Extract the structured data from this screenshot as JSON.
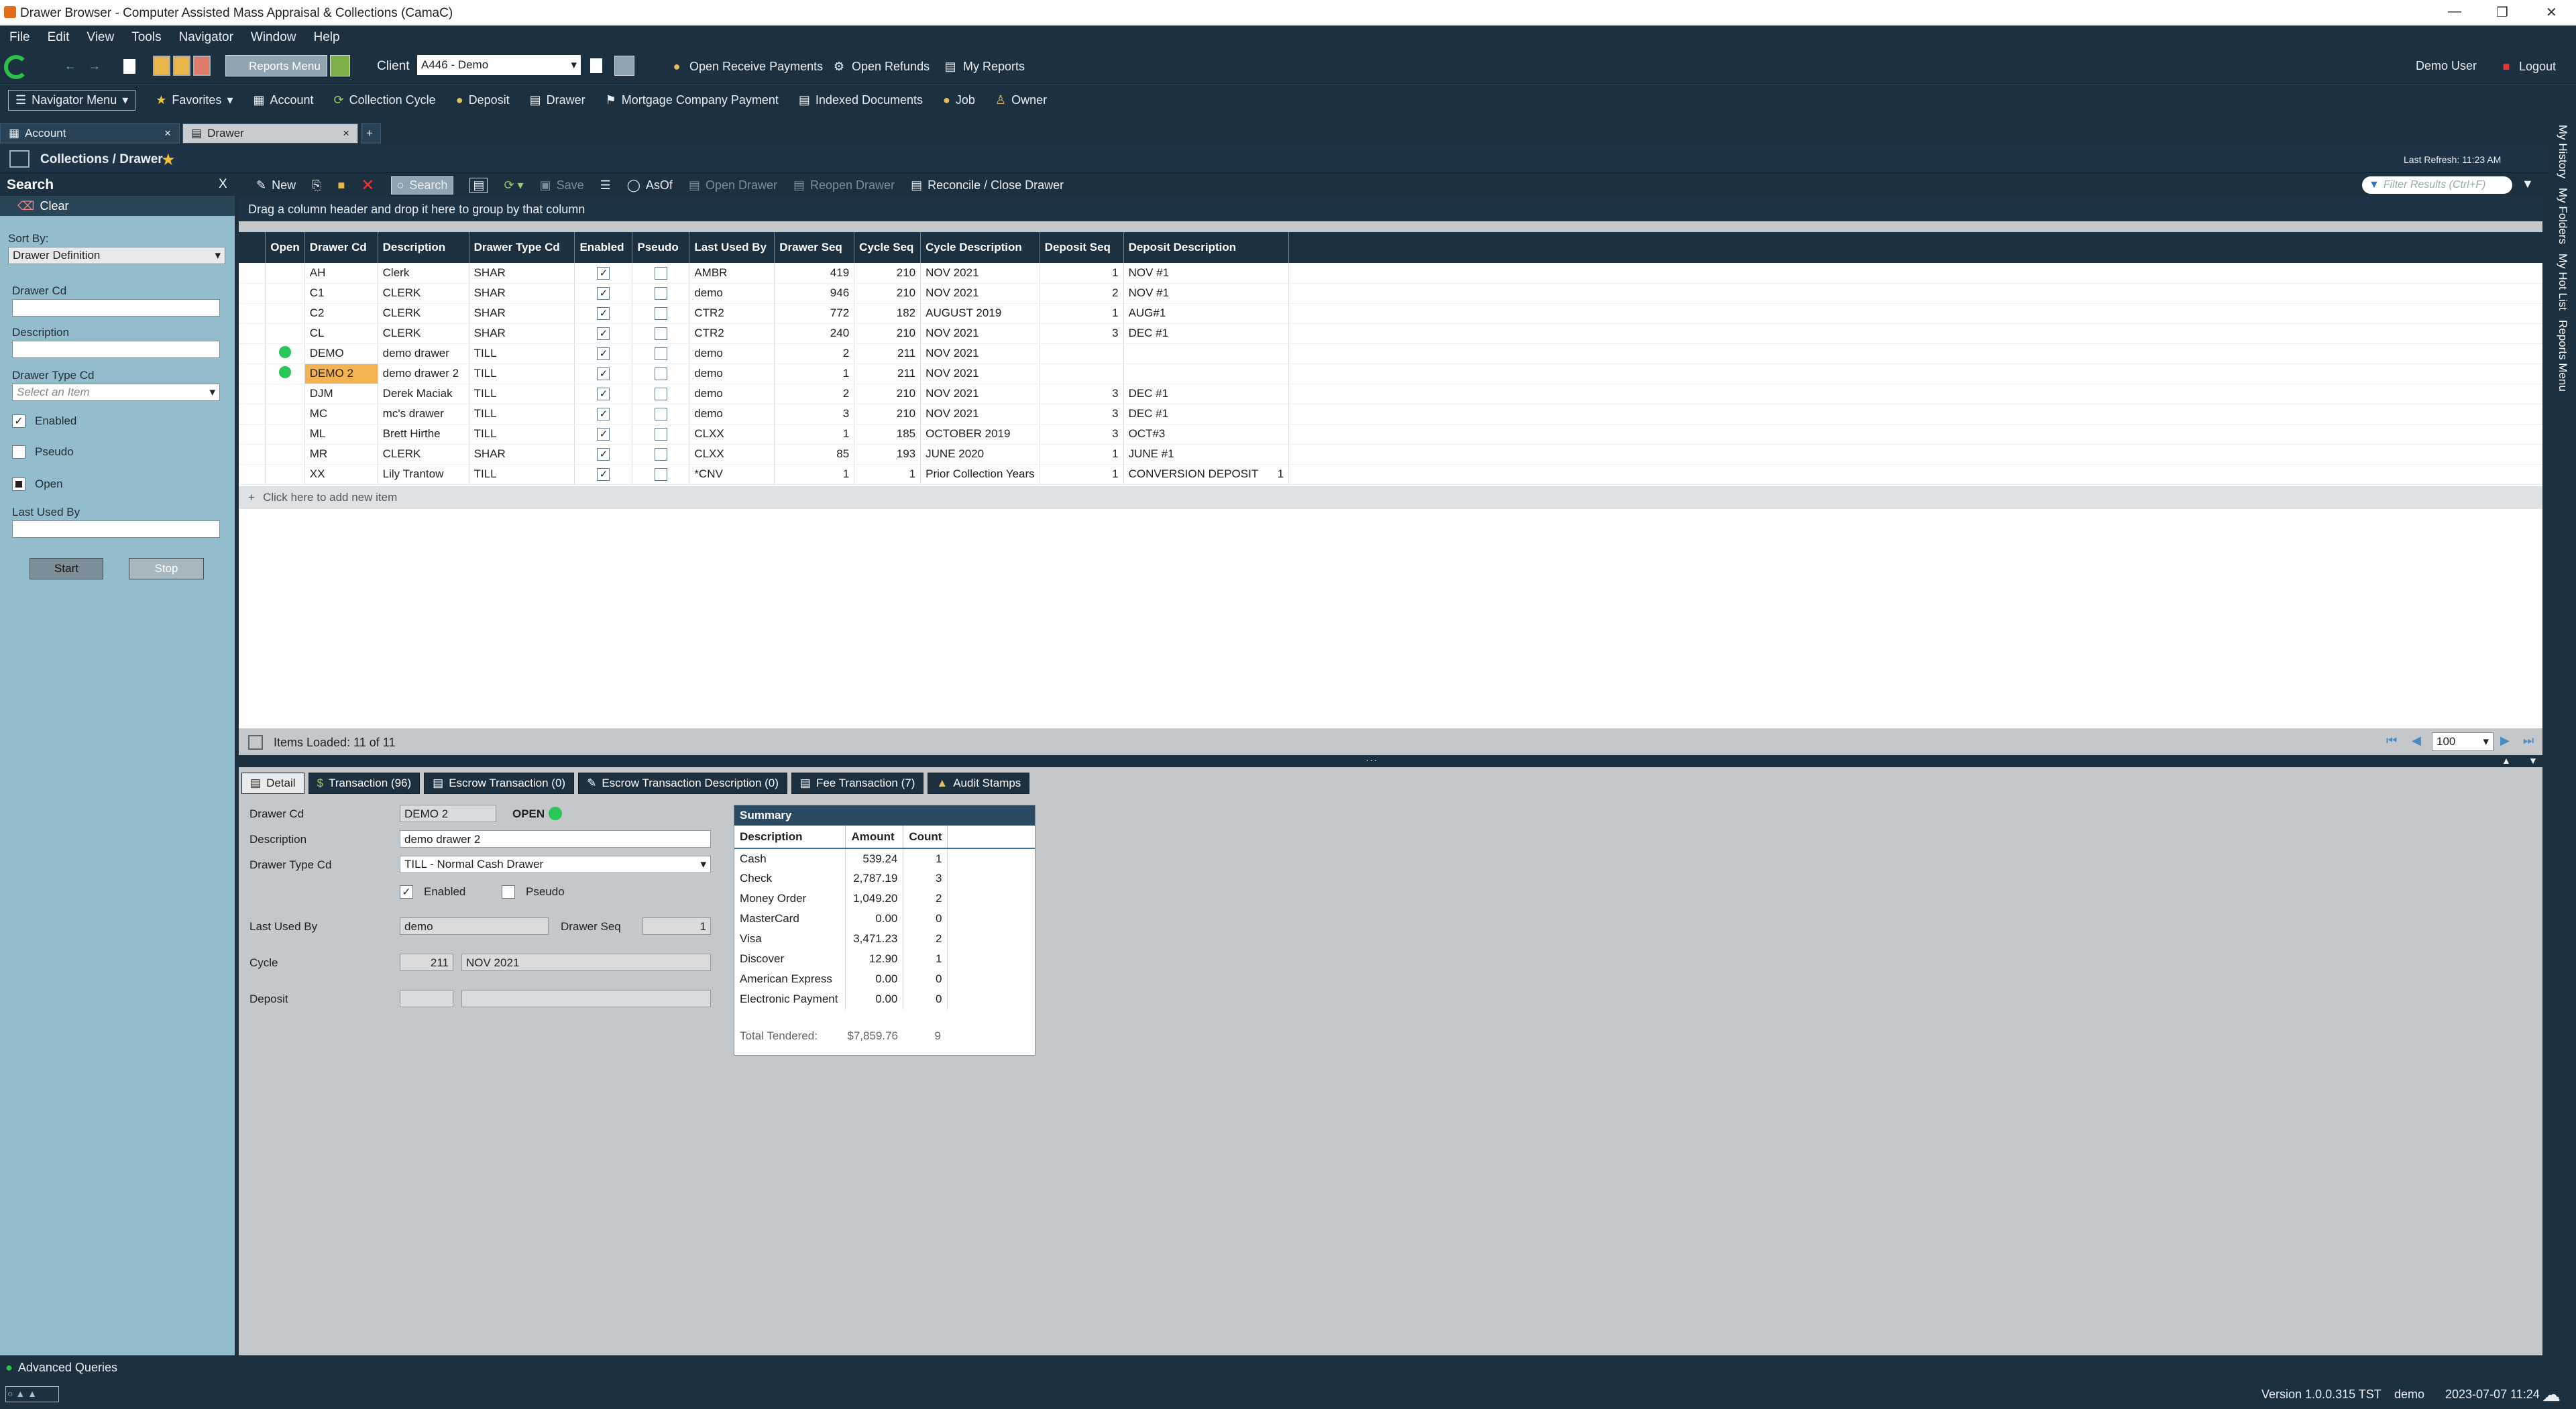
{
  "window": {
    "title": "Drawer Browser - Computer Assisted Mass Appraisal & Collections (CamaC)"
  },
  "menu": [
    "File",
    "Edit",
    "View",
    "Tools",
    "Navigator",
    "Window",
    "Help"
  ],
  "toolbar": {
    "reports_menu": "Reports Menu",
    "client_label": "Client",
    "client_value": "A446 - Demo",
    "open_receive_payments": "Open Receive Payments",
    "open_refunds": "Open Refunds",
    "my_reports": "My Reports",
    "user": "Demo User",
    "logout": "Logout"
  },
  "navbar": {
    "navigator_menu": "Navigator Menu",
    "favorites": "Favorites",
    "items": [
      "Account",
      "Collection Cycle",
      "Deposit",
      "Drawer",
      "Mortgage Company Payment",
      "Indexed Documents",
      "Job",
      "Owner"
    ]
  },
  "doc_tabs": [
    {
      "label": "Account"
    },
    {
      "label": "Drawer"
    }
  ],
  "breadcrumb": {
    "title": "Collections / Drawer",
    "last_refresh": "Last Refresh:  11:23 AM"
  },
  "search_panel": {
    "title": "Search",
    "close": "X",
    "clear": "Clear",
    "sort_by_label": "Sort By:",
    "sort_by_value": "Drawer Definition",
    "drawer_cd_label": "Drawer Cd",
    "description_label": "Description",
    "drawer_type_label": "Drawer Type Cd",
    "drawer_type_placeholder": "Select an Item",
    "enabled_label": "Enabled",
    "pseudo_label": "Pseudo",
    "open_label": "Open",
    "last_used_by_label": "Last Used By",
    "start": "Start",
    "stop": "Stop"
  },
  "grid_toolbar": {
    "new": "New",
    "search": "Search",
    "save": "Save",
    "asof": "AsOf",
    "open_drawer": "Open Drawer",
    "reopen_drawer": "Reopen Drawer",
    "reconcile": "Reconcile / Close Drawer",
    "filter_placeholder": "Filter Results (Ctrl+F)"
  },
  "group_hint": "Drag a column header and drop it here to group by that column",
  "grid": {
    "columns": [
      "Open",
      "Drawer Cd",
      "Description",
      "Drawer Type Cd",
      "Enabled",
      "Pseudo",
      "Last Used By",
      "Drawer Seq",
      "Cycle Seq",
      "Cycle Description",
      "Deposit Seq",
      "Deposit Description"
    ],
    "rows": [
      {
        "open": false,
        "cd": "AH",
        "desc": "Clerk",
        "type": "SHAR",
        "enabled": true,
        "pseudo": false,
        "last": "AMBR",
        "dseq": "419",
        "cseq": "210",
        "cdesc": "NOV 2021",
        "depseq": "1",
        "depdesc": "NOV #1",
        "extra": ""
      },
      {
        "open": false,
        "cd": "C1",
        "desc": "CLERK",
        "type": "SHAR",
        "enabled": true,
        "pseudo": false,
        "last": "demo",
        "dseq": "946",
        "cseq": "210",
        "cdesc": "NOV 2021",
        "depseq": "2",
        "depdesc": "NOV #1",
        "extra": ""
      },
      {
        "open": false,
        "cd": "C2",
        "desc": "CLERK",
        "type": "SHAR",
        "enabled": true,
        "pseudo": false,
        "last": "CTR2",
        "dseq": "772",
        "cseq": "182",
        "cdesc": "AUGUST 2019",
        "depseq": "1",
        "depdesc": "AUG#1",
        "extra": ""
      },
      {
        "open": false,
        "cd": "CL",
        "desc": "CLERK",
        "type": "SHAR",
        "enabled": true,
        "pseudo": false,
        "last": "CTR2",
        "dseq": "240",
        "cseq": "210",
        "cdesc": "NOV 2021",
        "depseq": "3",
        "depdesc": "DEC #1",
        "extra": ""
      },
      {
        "open": true,
        "cd": "DEMO",
        "desc": "demo drawer",
        "type": "TILL",
        "enabled": true,
        "pseudo": false,
        "last": "demo",
        "dseq": "2",
        "cseq": "211",
        "cdesc": "NOV 2021",
        "depseq": "",
        "depdesc": "",
        "extra": ""
      },
      {
        "open": true,
        "cd": "DEMO 2",
        "desc": "demo drawer 2",
        "type": "TILL",
        "enabled": true,
        "pseudo": false,
        "last": "demo",
        "dseq": "1",
        "cseq": "211",
        "cdesc": "NOV 2021",
        "depseq": "",
        "depdesc": "",
        "extra": "",
        "selected": true
      },
      {
        "open": false,
        "cd": "DJM",
        "desc": "Derek Maciak",
        "type": "TILL",
        "enabled": true,
        "pseudo": false,
        "last": "demo",
        "dseq": "2",
        "cseq": "210",
        "cdesc": "NOV 2021",
        "depseq": "3",
        "depdesc": "DEC #1",
        "extra": ""
      },
      {
        "open": false,
        "cd": "MC",
        "desc": "mc's drawer",
        "type": "TILL",
        "enabled": true,
        "pseudo": false,
        "last": "demo",
        "dseq": "3",
        "cseq": "210",
        "cdesc": "NOV 2021",
        "depseq": "3",
        "depdesc": "DEC #1",
        "extra": ""
      },
      {
        "open": false,
        "cd": "ML",
        "desc": "Brett Hirthe",
        "type": "TILL",
        "enabled": true,
        "pseudo": false,
        "last": "CLXX",
        "dseq": "1",
        "cseq": "185",
        "cdesc": "OCTOBER 2019",
        "depseq": "3",
        "depdesc": "OCT#3",
        "extra": ""
      },
      {
        "open": false,
        "cd": "MR",
        "desc": "CLERK",
        "type": "SHAR",
        "enabled": true,
        "pseudo": false,
        "last": "CLXX",
        "dseq": "85",
        "cseq": "193",
        "cdesc": "JUNE 2020",
        "depseq": "1",
        "depdesc": "JUNE #1",
        "extra": ""
      },
      {
        "open": false,
        "cd": "XX",
        "desc": "Lily Trantow",
        "type": "TILL",
        "enabled": true,
        "pseudo": false,
        "last": "*CNV",
        "dseq": "1",
        "cseq": "1",
        "cdesc": "Prior Collection Years",
        "depseq": "1",
        "depdesc": "CONVERSION DEPOSIT",
        "extra": "1"
      }
    ],
    "add_new": "Click here to add new item",
    "items_loaded": "Items Loaded:  11 of 11",
    "page_size": "100"
  },
  "detail_tabs": [
    "Detail",
    "Transaction (96)",
    "Escrow Transaction (0)",
    "Escrow Transaction Description (0)",
    "Fee Transaction (7)",
    "Audit Stamps"
  ],
  "detail": {
    "drawer_cd_label": "Drawer Cd",
    "drawer_cd": "DEMO 2",
    "status": "OPEN",
    "description_label": "Description",
    "description": "demo drawer 2",
    "type_label": "Drawer Type Cd",
    "type_value": "TILL - Normal Cash Drawer",
    "enabled_label": "Enabled",
    "pseudo_label": "Pseudo",
    "last_used_label": "Last Used By",
    "last_used": "demo",
    "drawer_seq_label": "Drawer Seq",
    "drawer_seq": "1",
    "cycle_label": "Cycle",
    "cycle_num": "211",
    "cycle_desc": "NOV 2021",
    "deposit_label": "Deposit"
  },
  "summary": {
    "title": "Summary",
    "columns": [
      "Description",
      "Amount",
      "Count"
    ],
    "rows": [
      {
        "d": "Cash",
        "a": "539.24",
        "c": "1"
      },
      {
        "d": "Check",
        "a": "2,787.19",
        "c": "3"
      },
      {
        "d": "Money Order",
        "a": "1,049.20",
        "c": "2"
      },
      {
        "d": "MasterCard",
        "a": "0.00",
        "c": "0"
      },
      {
        "d": "Visa",
        "a": "3,471.23",
        "c": "2"
      },
      {
        "d": "Discover",
        "a": "12.90",
        "c": "1"
      },
      {
        "d": "American Express",
        "a": "0.00",
        "c": "0"
      },
      {
        "d": "Electronic Payment",
        "a": "0.00",
        "c": "0"
      }
    ],
    "total_label": "Total Tendered:",
    "total_amount": "$7,859.76",
    "total_count": "9"
  },
  "right_tabs": [
    "My History",
    "My Folders",
    "My Hot List",
    "Reports Menu"
  ],
  "bottom": {
    "advanced_queries": "Advanced Queries",
    "version": "Version 1.0.0.315 TST",
    "user": "demo",
    "datetime": "2023-07-07  11:24"
  },
  "colors": {
    "chrome": "#1d3040",
    "sidebar": "#93bccd",
    "open_dot": "#29c65a",
    "selected_cell": "#f4b353"
  }
}
